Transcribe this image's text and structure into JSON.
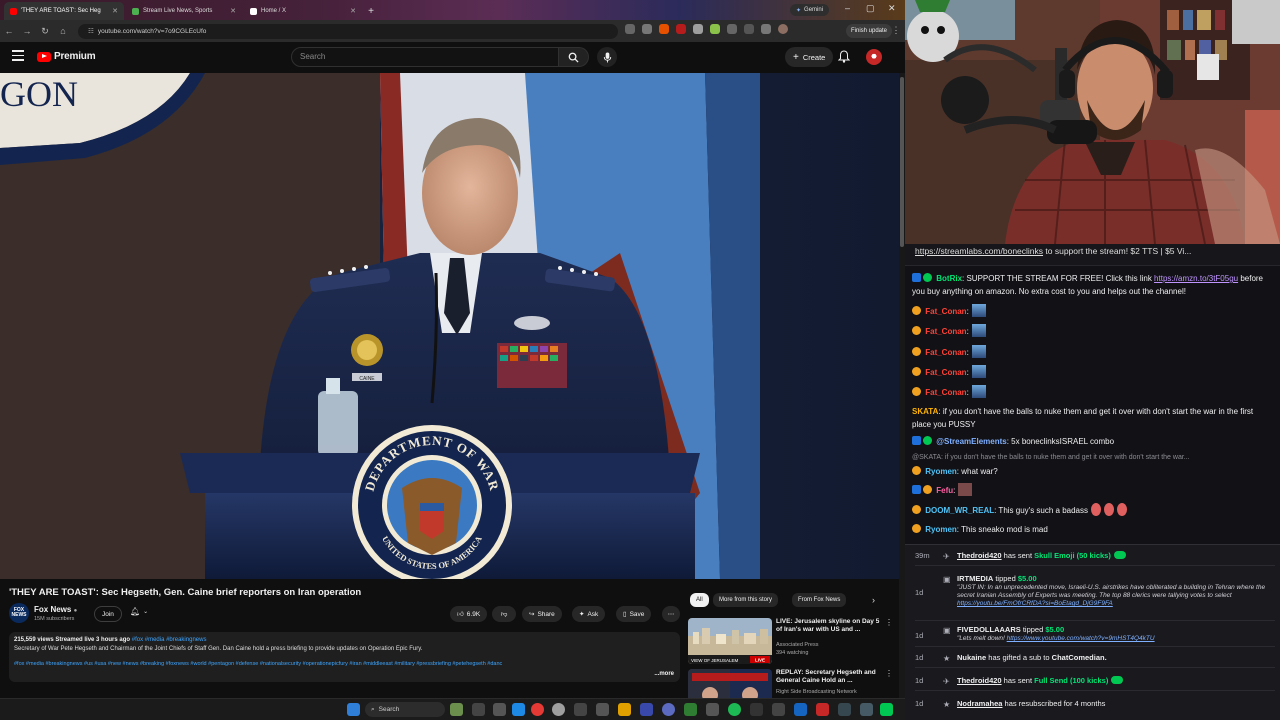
{
  "browser": {
    "tabs": [
      {
        "label": "'THEY ARE TOAST': Sec Heg",
        "active": true,
        "favicon_color": "#ff0000"
      },
      {
        "label": "Stream Live News, Sports",
        "active": false,
        "favicon_color": "#4caf50"
      },
      {
        "label": "Home / X",
        "active": false,
        "favicon_color": "#ffffff"
      }
    ],
    "gemini_label": "Gemini",
    "url": "youtube.com/watch?v=7o9CGLEcUfo",
    "finish_update_label": "Finish update"
  },
  "youtube": {
    "logo_text": "Premium",
    "search_placeholder": "Search",
    "create_label": "Create",
    "video": {
      "title": "'THEY ARE TOAST': Sec Hegseth, Gen. Caine brief reporters on Iran operation",
      "backdrop_text": "GON",
      "seal_top": "DEPARTMENT OF WAR",
      "seal_bottom": "UNITED STATES OF AMERICA",
      "nameplate": "CAINE"
    },
    "channel": {
      "name": "Fox News",
      "subs": "15M subscribers",
      "avatar_text_1": "FOX",
      "avatar_text_2": "NEWS"
    },
    "join_label": "Join",
    "likes": "6.9K",
    "share_label": "Share",
    "ask_label": "Ask",
    "save_label": "Save",
    "description": {
      "meta": "215,559 views  Streamed live 3 hours ago",
      "meta_tags": "#fox #media #breakingnews",
      "text": "Secretary of War Pete Hegseth and Chairman of the Joint Chiefs of Staff Gen. Dan Caine hold a press briefing to provide updates on Operation Epic Fury.",
      "tags": "#fox #media #breakingnews #us #usa #new #news #breaking #foxnews #world #pentagon #defense #nationalsecurity #operationepicfury #iran #middleeast #military #pressbriefing #petehegseth #danc",
      "more": "...more"
    },
    "chips": [
      "All",
      "More from this story",
      "From Fox News"
    ],
    "recommendations": [
      {
        "title": "LIVE: Jerusalem skyline on Day 5 of Iran's war with US and ...",
        "channel": "Associated Press",
        "watching": "394 watching",
        "badge": "LIVE",
        "thumb_text": "VIEW OF JERUSALEM"
      },
      {
        "title": "REPLAY: Secretary Hegseth and General Caine Hold an ...",
        "channel": "Right Side Broadcasting Network",
        "watching": "",
        "badge": "",
        "thumb_text": ""
      }
    ]
  },
  "taskbar": {
    "search_label": "Search"
  },
  "chat": {
    "pinned": {
      "link": "https://streamlabs.com/boneclinks",
      "text": " to support the stream! $2 TTS | $5 Vi..."
    },
    "messages": [
      {
        "user": "BotRix",
        "user_color": "#00e676",
        "text": ": SUPPORT THE STREAM FOR FREE! Click this link ",
        "link": "https://amzn.to/3tF05gu",
        "text2": " before you buy anything on amazon. No extra cost to you and helps out the channel!"
      },
      {
        "user": "Fat_Conan",
        "user_color": "#ff4136",
        "text": ":"
      },
      {
        "user": "Fat_Conan",
        "user_color": "#ff4136",
        "text": ":"
      },
      {
        "user": "Fat_Conan",
        "user_color": "#ff4136",
        "text": ":"
      },
      {
        "user": "Fat_Conan",
        "user_color": "#ff4136",
        "text": ":"
      },
      {
        "user": "Fat_Conan",
        "user_color": "#ff4136",
        "text": ":"
      },
      {
        "user": "SKATA",
        "user_color": "#ffb300",
        "text": ": if you don't have the balls to nuke them and get it over with don't start the war in the first place you PUSSY"
      },
      {
        "user": "@StreamElements",
        "user_color": "#7fb0ff",
        "text": ": 5x boneclinksISRAEL combo"
      },
      {
        "user": "",
        "user_color": "#8a8a92",
        "text": "@SKATA: if you don't have the balls to nuke them and get it over with don't start the war..."
      },
      {
        "user": "Ryomen",
        "user_color": "#4fc3f7",
        "text": ": what war?"
      },
      {
        "user": "Fefu",
        "user_color": "#ff5fa2",
        "text": ":"
      },
      {
        "user": "DOOM_WR_REAL",
        "user_color": "#4fc3f7",
        "text": ": This guy's such a badass"
      },
      {
        "user": "Ryomen",
        "user_color": "#4fc3f7",
        "text": ": This sneako mod is mad"
      }
    ]
  },
  "feed": [
    {
      "time": "39m",
      "user": "Thedroid420",
      "text": " has sent ",
      "item": "Skull Emoji (50 kicks)",
      "quote": "",
      "link": ""
    },
    {
      "time": "1d",
      "user": "IRTMEDIA",
      "text": " tipped ",
      "item": "$5.00",
      "quote": "\"JUST IN: In an unprecedented move, Israeli-U.S. airstrikes have obliterated a building in Tehran where the secret Iranian Assembly of Experts was meeting. The top 88 clerics were tallying votes to select ",
      "link": "https://youtu.be/FmOfrCRfDA?si=BoEtagd_DjG9F9FA"
    },
    {
      "time": "1d",
      "user": "FIVEDOLLAAARS",
      "text": " tipped ",
      "item": "$5.00",
      "quote": "\"Lets melt down! ",
      "link": "https://www.youtube.com/watch?v=9mHST4Q4kTU"
    },
    {
      "time": "1d",
      "user": "Nukaine",
      "text": " has gifted a sub to ",
      "item": "ChatComedian.",
      "quote": "",
      "link": ""
    },
    {
      "time": "1d",
      "user": "Thedroid420",
      "text": " has sent ",
      "item": "Full Send (100 kicks)",
      "quote": "",
      "link": ""
    },
    {
      "time": "1d",
      "user": "Nodramahea",
      "text": " has resubscribed for 4 months",
      "item": "",
      "quote": "",
      "link": ""
    }
  ]
}
